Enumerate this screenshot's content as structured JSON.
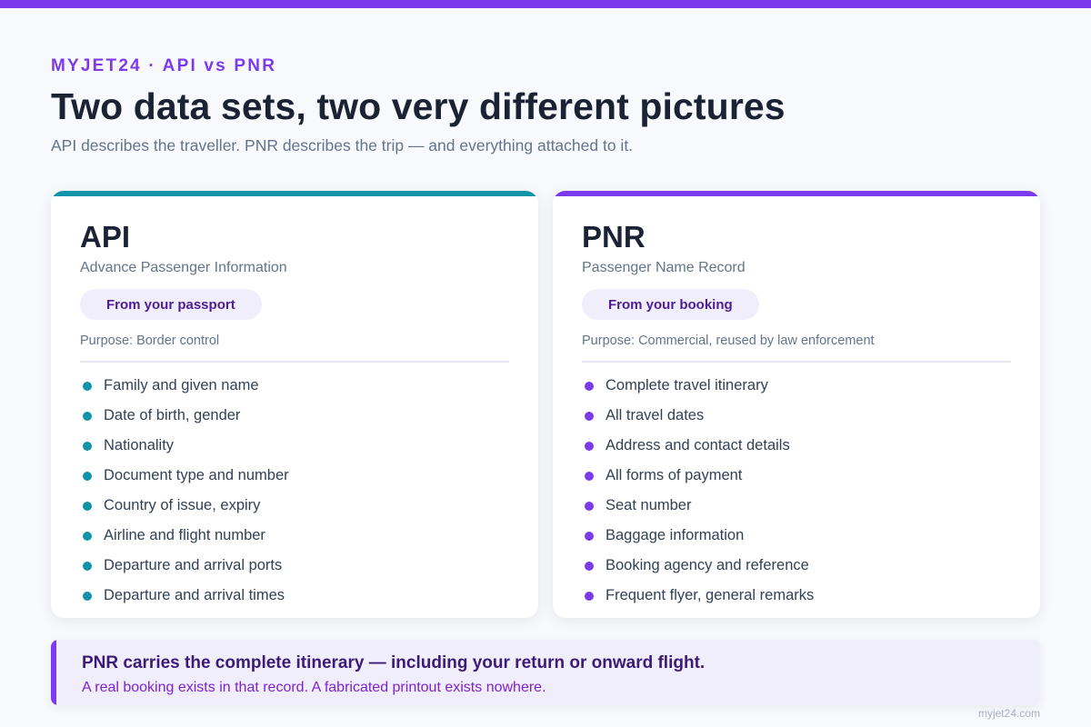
{
  "header": {
    "eyebrow": "MYJET24 · API vs PNR",
    "title": "Two data sets, two very different pictures",
    "subtitle": "API describes the traveller. PNR describes the trip — and everything attached to it."
  },
  "cards": [
    {
      "title": "API",
      "subtitle": "Advance Passenger Information",
      "pill": "From your passport",
      "purpose": "Purpose: Border control",
      "items": [
        "Family and given name",
        "Date of birth, gender",
        "Nationality",
        "Document type and number",
        "Country of issue, expiry",
        "Airline and flight number",
        "Departure and arrival ports",
        "Departure and arrival times"
      ]
    },
    {
      "title": "PNR",
      "subtitle": "Passenger Name Record",
      "pill": "From your booking",
      "purpose": "Purpose: Commercial, reused by law enforcement",
      "items": [
        "Complete travel itinerary",
        "All travel dates",
        "Address and contact details",
        "All forms of payment",
        "Seat number",
        "Baggage information",
        "Booking agency and reference",
        "Frequent flyer, general remarks"
      ]
    }
  ],
  "callout": {
    "main": "PNR carries the complete itinerary — including your return or onward flight.",
    "sub": "A real booking exists in that record. A fabricated printout exists nowhere."
  },
  "footer": {
    "source": "myjet24.com"
  },
  "colors": {
    "brand_purple": "#7c3aed",
    "api_teal": "#0f93a8",
    "pill_background": "#f1eefc"
  }
}
